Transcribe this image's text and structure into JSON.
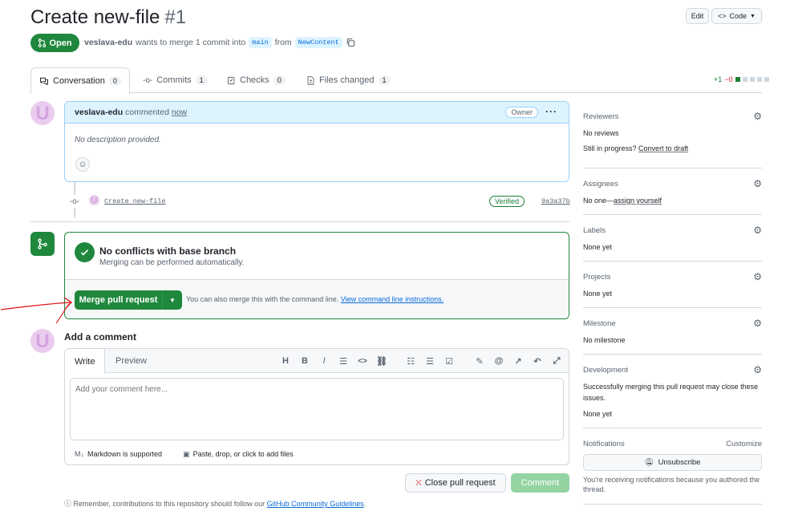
{
  "header": {
    "title": "Create new-file",
    "number": "#1",
    "edit_label": "Edit",
    "code_label": "Code",
    "state": "Open",
    "author": "veslava-edu",
    "merge_text": "wants to merge 1 commit into",
    "base_branch": "main",
    "from_text": "from",
    "head_branch": "NewContent"
  },
  "tabs": [
    {
      "label": "Conversation",
      "count": "0"
    },
    {
      "label": "Commits",
      "count": "1"
    },
    {
      "label": "Checks",
      "count": "0"
    },
    {
      "label": "Files changed",
      "count": "1"
    }
  ],
  "diffstat": {
    "additions": "+1",
    "deletions": "−0"
  },
  "comment": {
    "author": "veslava-edu",
    "verb": "commented",
    "time": "now",
    "role": "Owner",
    "body": "No description provided."
  },
  "commit": {
    "message": "Create new-file",
    "verified": "Verified",
    "sha": "9a3a37b"
  },
  "merge": {
    "title": "No conflicts with base branch",
    "subtitle": "Merging can be performed automatically.",
    "button_label": "Merge pull request",
    "hint": "You can also merge this with the command line.",
    "hint_link": "View command line instructions."
  },
  "add_comment": {
    "title": "Add a comment",
    "write_tab": "Write",
    "preview_tab": "Preview",
    "placeholder": "Add your comment here...",
    "markdown_note": "Markdown is supported",
    "attach_note": "Paste, drop, or click to add files",
    "close_label": "Close pull request",
    "comment_label": "Comment",
    "guidelines_prefix": "Remember, contributions to this repository should follow our",
    "guidelines_link": "GitHub Community Guidelines",
    "guidelines_suffix": "."
  },
  "sidebar": {
    "reviewers": {
      "label": "Reviewers",
      "value": "No reviews",
      "progress": "Still in progress?",
      "convert": "Convert to draft"
    },
    "assignees": {
      "label": "Assignees",
      "value": "No one—",
      "assign": "assign yourself"
    },
    "labels": {
      "label": "Labels",
      "value": "None yet"
    },
    "projects": {
      "label": "Projects",
      "value": "None yet"
    },
    "milestone": {
      "label": "Milestone",
      "value": "No milestone"
    },
    "development": {
      "label": "Development",
      "desc": "Successfully merging this pull request may close these issues.",
      "value": "None yet"
    },
    "notifications": {
      "label": "Notifications",
      "customize": "Customize",
      "unsubscribe": "Unsubscribe",
      "reason": "You're receiving notifications because you authored the thread."
    }
  },
  "colors": {
    "accent_green": "#1f883d",
    "link_blue": "#0969da",
    "annotation_red": "#e0161a"
  }
}
